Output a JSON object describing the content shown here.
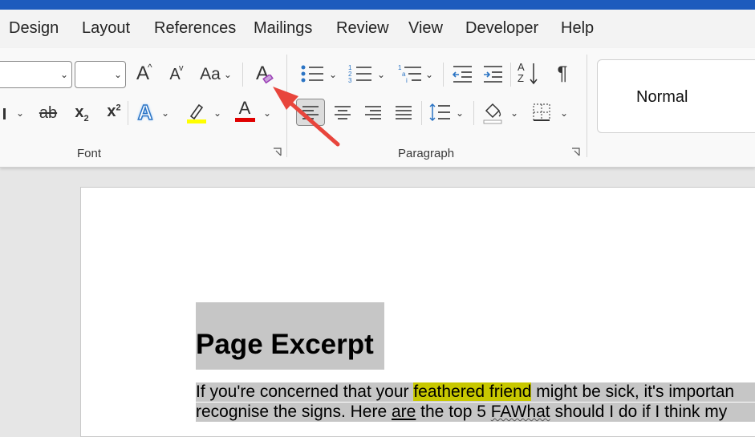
{
  "tabs": [
    "Design",
    "Layout",
    "References",
    "Mailings",
    "Review",
    "View",
    "Developer",
    "Help"
  ],
  "ribbon": {
    "font_group_label": "Font",
    "paragraph_group_label": "Paragraph",
    "grow_font_glyph": "A",
    "shrink_font_glyph": "A",
    "change_case_glyph": "Aa",
    "clear_formatting_glyph": "A",
    "strikethrough_glyph": "ab",
    "subscript_base": "x",
    "subscript_sub": "2",
    "superscript_base": "x",
    "superscript_sup": "2",
    "text_effects_glyph": "A",
    "font_color_glyph": "A",
    "show_marks_glyph": "¶",
    "sort_a": "A",
    "sort_z": "Z",
    "highlight_color": "#ffff00",
    "font_color": "#e00000",
    "accent_purple": "#9b3fb5"
  },
  "styles": {
    "current": "Normal"
  },
  "document": {
    "heading": "Page Excerpt",
    "line1": {
      "before": "If you're concerned that your ",
      "highlight": "feathered friend",
      "after": " might be sick, it's importan"
    },
    "line2": {
      "before": "recognise the signs. Here ",
      "underlined": "are",
      "middle": " the top 5 ",
      "squiggle": "FAWhat",
      "after": " should I do if I think my"
    }
  },
  "annotation": {
    "arrow_color": "#e8453c"
  }
}
